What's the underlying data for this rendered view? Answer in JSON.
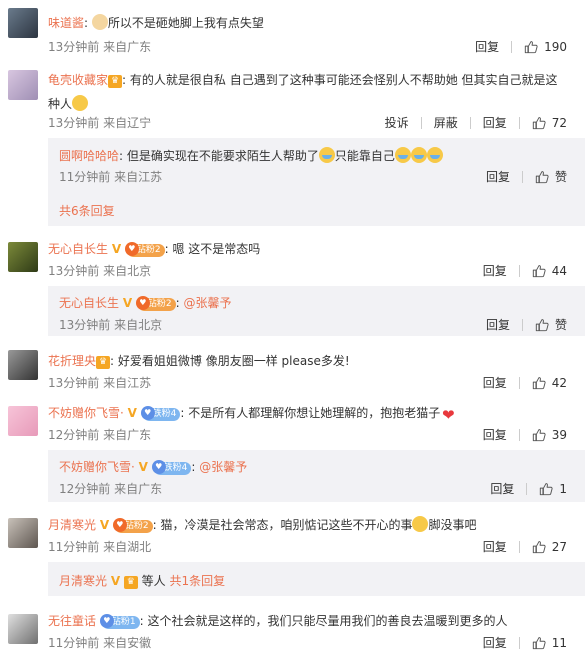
{
  "comments": [
    {
      "name": "味道酱",
      "text": "所以不是砸她脚上我有点失望",
      "time": "13分钟前",
      "loc": "来自广东",
      "reply": "回复",
      "likes": "190"
    },
    {
      "name": "龟壳收藏家",
      "text": "有的人就是很自私 自己遇到了这种事可能还会怪别人不帮助她 但其实自己就是这",
      "text2": "种人",
      "time": "13分钟前",
      "loc": "来自辽宁",
      "report": "投诉",
      "block": "屏蔽",
      "reply": "回复",
      "likes": "72",
      "sub": {
        "name": "圆啊哈哈哈",
        "text": "但是确实现在不能要求陌生人帮助了",
        "text_b": "只能靠自己",
        "time": "11分钟前",
        "loc": "来自江苏",
        "reply": "回复",
        "likes": "赞",
        "more": "共6条回复"
      }
    },
    {
      "name": "无心自长生",
      "badge": "钻粉2",
      "text": "嗯 这不是常态吗",
      "time": "13分钟前",
      "loc": "来自北京",
      "reply": "回复",
      "likes": "44",
      "sub": {
        "name": "无心自长生",
        "badge": "钻粉2",
        "text": "@张馨予",
        "time": "13分钟前",
        "loc": "来自北京",
        "reply": "回复",
        "likes": "赞"
      }
    },
    {
      "name": "花折理央",
      "text": "好爱看姐姐微博 像朋友圈一样 please多发!",
      "time": "13分钟前",
      "loc": "来自江苏",
      "reply": "回复",
      "likes": "42"
    },
    {
      "name": "不妨赠你飞雪·",
      "badge": "铁粉4",
      "text": "不是所有人都理解你想让她理解的，抱抱老猫子",
      "time": "12分钟前",
      "loc": "来自广东",
      "reply": "回复",
      "likes": "39",
      "sub": {
        "name": "不妨赠你飞雪·",
        "badge": "铁粉4",
        "text": "@张馨予",
        "time": "12分钟前",
        "loc": "来自广东",
        "reply": "回复",
        "likes": "1"
      }
    },
    {
      "name": "月清寒光",
      "badge": "钻粉2",
      "text": "猫，冷漠是社会常态，咱别惦记这些不开心的事",
      "text_b": "脚没事吧",
      "time": "11分钟前",
      "loc": "来自湖北",
      "reply": "回复",
      "likes": "27",
      "sub": {
        "name": "月清寒光",
        "others": "等人",
        "more": "共1条回复"
      }
    },
    {
      "name": "无往童话",
      "badge": "钻粉1",
      "text": "这个社会就是这样的，我们只能尽量用我们的善良去温暖到更多的人",
      "time": "11分钟前",
      "loc": "来自安徽",
      "reply": "回复",
      "likes": "11"
    }
  ],
  "icons": {
    "like": "thumbs-up-icon",
    "crying": "crying-emoji-icon",
    "heart": "heart-emoji-icon"
  },
  "colors": {
    "name": "#eb7350",
    "meta": "#808080",
    "reply_bg": "#f2f2f5"
  }
}
